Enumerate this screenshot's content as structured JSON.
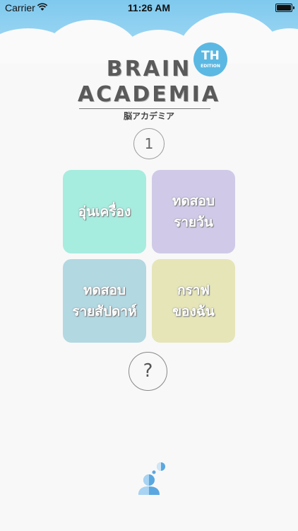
{
  "status_bar": {
    "carrier": "Carrier",
    "time": "11:26 AM"
  },
  "logo": {
    "line1": "BRAIN",
    "line2": "ACADEMIA",
    "subtitle": "脳アカデミア",
    "badge_main": "TH",
    "badge_sub": "EDITION"
  },
  "level": "1",
  "menu": [
    {
      "label": "อุ่นเครื่อง",
      "color": "#a6ecdf"
    },
    {
      "label": "ทดสอบ\nรายวัน",
      "color": "#d0cae8"
    },
    {
      "label": "ทดสอบ\nรายสัปดาห์",
      "color": "#b2d8e2"
    },
    {
      "label": "กราฟ\nของฉัน",
      "color": "#e5e5b8"
    }
  ],
  "help_label": "?",
  "icons": {
    "wifi": "wifi-icon",
    "battery": "battery-icon",
    "mascot": "brain-person-icon"
  }
}
